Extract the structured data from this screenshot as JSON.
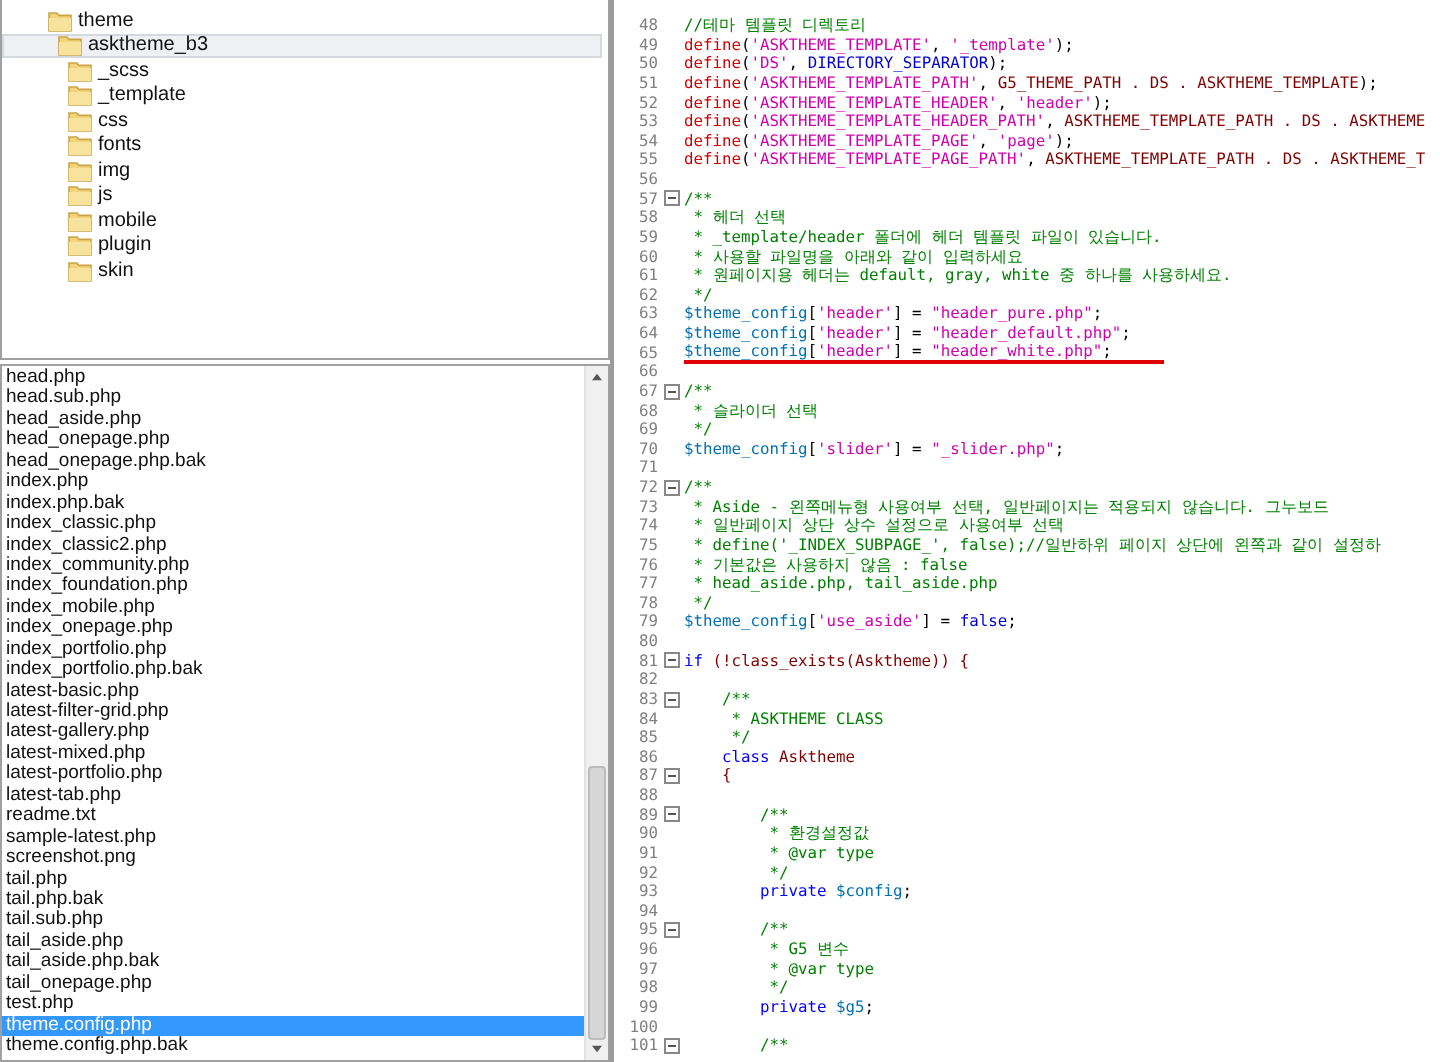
{
  "folder_tree": [
    {
      "label": "theme",
      "selected": false,
      "children": [
        {
          "label": "asktheme_b3",
          "selected": true,
          "children": [
            {
              "label": "_scss",
              "selected": false
            },
            {
              "label": "_template",
              "selected": false
            },
            {
              "label": "css",
              "selected": false
            },
            {
              "label": "fonts",
              "selected": false
            },
            {
              "label": "img",
              "selected": false
            },
            {
              "label": "js",
              "selected": false
            },
            {
              "label": "mobile",
              "selected": false
            },
            {
              "label": "plugin",
              "selected": false
            },
            {
              "label": "skin",
              "selected": false
            }
          ]
        }
      ]
    }
  ],
  "file_list": [
    {
      "name": "head.php",
      "selected": false
    },
    {
      "name": "head.sub.php",
      "selected": false
    },
    {
      "name": "head_aside.php",
      "selected": false
    },
    {
      "name": "head_onepage.php",
      "selected": false
    },
    {
      "name": "head_onepage.php.bak",
      "selected": false
    },
    {
      "name": "index.php",
      "selected": false
    },
    {
      "name": "index.php.bak",
      "selected": false
    },
    {
      "name": "index_classic.php",
      "selected": false
    },
    {
      "name": "index_classic2.php",
      "selected": false
    },
    {
      "name": "index_community.php",
      "selected": false
    },
    {
      "name": "index_foundation.php",
      "selected": false
    },
    {
      "name": "index_mobile.php",
      "selected": false
    },
    {
      "name": "index_onepage.php",
      "selected": false
    },
    {
      "name": "index_portfolio.php",
      "selected": false
    },
    {
      "name": "index_portfolio.php.bak",
      "selected": false
    },
    {
      "name": "latest-basic.php",
      "selected": false
    },
    {
      "name": "latest-filter-grid.php",
      "selected": false
    },
    {
      "name": "latest-gallery.php",
      "selected": false
    },
    {
      "name": "latest-mixed.php",
      "selected": false
    },
    {
      "name": "latest-portfolio.php",
      "selected": false
    },
    {
      "name": "latest-tab.php",
      "selected": false
    },
    {
      "name": "readme.txt",
      "selected": false
    },
    {
      "name": "sample-latest.php",
      "selected": false
    },
    {
      "name": "screenshot.png",
      "selected": false
    },
    {
      "name": "tail.php",
      "selected": false
    },
    {
      "name": "tail.php.bak",
      "selected": false
    },
    {
      "name": "tail.sub.php",
      "selected": false
    },
    {
      "name": "tail_aside.php",
      "selected": false
    },
    {
      "name": "tail_aside.php.bak",
      "selected": false
    },
    {
      "name": "tail_onepage.php",
      "selected": false
    },
    {
      "name": "test.php",
      "selected": false
    },
    {
      "name": "theme.config.php",
      "selected": true
    },
    {
      "name": "theme.config.php.bak",
      "selected": false
    }
  ],
  "code_lines": [
    {
      "number": "48",
      "fold": false,
      "underlined": false,
      "tokens": [
        {
          "kind": "comment",
          "text": "//테마 템플릿 디렉토리"
        }
      ]
    },
    {
      "number": "49",
      "fold": false,
      "underlined": false,
      "tokens": [
        {
          "kind": "function",
          "text": "define"
        },
        {
          "kind": "plain",
          "text": "("
        },
        {
          "kind": "string",
          "text": "'ASKTHEME_TEMPLATE'"
        },
        {
          "kind": "plain",
          "text": ", "
        },
        {
          "kind": "string",
          "text": "'_template'"
        },
        {
          "kind": "plain",
          "text": ");"
        }
      ]
    },
    {
      "number": "50",
      "fold": false,
      "underlined": false,
      "tokens": [
        {
          "kind": "function",
          "text": "define"
        },
        {
          "kind": "plain",
          "text": "("
        },
        {
          "kind": "string",
          "text": "'DS'"
        },
        {
          "kind": "plain",
          "text": ", "
        },
        {
          "kind": "constant",
          "text": "DIRECTORY_SEPARATOR"
        },
        {
          "kind": "plain",
          "text": ");"
        }
      ]
    },
    {
      "number": "51",
      "fold": false,
      "underlined": false,
      "tokens": [
        {
          "kind": "function",
          "text": "define"
        },
        {
          "kind": "plain",
          "text": "("
        },
        {
          "kind": "string",
          "text": "'ASKTHEME_TEMPLATE_PATH'"
        },
        {
          "kind": "plain",
          "text": ", "
        },
        {
          "kind": "identifier",
          "text": "G5_THEME_PATH . DS . ASKTHEME_TEMPLATE"
        },
        {
          "kind": "plain",
          "text": ");"
        }
      ]
    },
    {
      "number": "52",
      "fold": false,
      "underlined": false,
      "tokens": [
        {
          "kind": "function",
          "text": "define"
        },
        {
          "kind": "plain",
          "text": "("
        },
        {
          "kind": "string",
          "text": "'ASKTHEME_TEMPLATE_HEADER'"
        },
        {
          "kind": "plain",
          "text": ", "
        },
        {
          "kind": "string",
          "text": "'header'"
        },
        {
          "kind": "plain",
          "text": ");"
        }
      ]
    },
    {
      "number": "53",
      "fold": false,
      "underlined": false,
      "tokens": [
        {
          "kind": "function",
          "text": "define"
        },
        {
          "kind": "plain",
          "text": "("
        },
        {
          "kind": "string",
          "text": "'ASKTHEME_TEMPLATE_HEADER_PATH'"
        },
        {
          "kind": "plain",
          "text": ", "
        },
        {
          "kind": "identifier",
          "text": "ASKTHEME_TEMPLATE_PATH . DS . ASKTHEME"
        }
      ]
    },
    {
      "number": "54",
      "fold": false,
      "underlined": false,
      "tokens": [
        {
          "kind": "function",
          "text": "define"
        },
        {
          "kind": "plain",
          "text": "("
        },
        {
          "kind": "string",
          "text": "'ASKTHEME_TEMPLATE_PAGE'"
        },
        {
          "kind": "plain",
          "text": ", "
        },
        {
          "kind": "string",
          "text": "'page'"
        },
        {
          "kind": "plain",
          "text": ");"
        }
      ]
    },
    {
      "number": "55",
      "fold": false,
      "underlined": false,
      "tokens": [
        {
          "kind": "function",
          "text": "define"
        },
        {
          "kind": "plain",
          "text": "("
        },
        {
          "kind": "string",
          "text": "'ASKTHEME_TEMPLATE_PAGE_PATH'"
        },
        {
          "kind": "plain",
          "text": ", "
        },
        {
          "kind": "identifier",
          "text": "ASKTHEME_TEMPLATE_PATH . DS . ASKTHEME_T"
        }
      ]
    },
    {
      "number": "56",
      "fold": false,
      "underlined": false
    },
    {
      "number": "57",
      "fold": true,
      "underlined": false,
      "tokens": [
        {
          "kind": "comment",
          "text": "/**"
        }
      ]
    },
    {
      "number": "58",
      "fold": false,
      "underlined": false,
      "tokens": [
        {
          "kind": "comment",
          "text": " * 헤더 선택"
        }
      ]
    },
    {
      "number": "59",
      "fold": false,
      "underlined": false,
      "tokens": [
        {
          "kind": "comment",
          "text": " * _template/header 폴더에 헤더 템플릿 파일이 있습니다."
        }
      ]
    },
    {
      "number": "60",
      "fold": false,
      "underlined": false,
      "tokens": [
        {
          "kind": "comment",
          "text": " * 사용할 파일명을 아래와 같이 입력하세요"
        }
      ]
    },
    {
      "number": "61",
      "fold": false,
      "underlined": false,
      "tokens": [
        {
          "kind": "comment",
          "text": " * 원페이지용 헤더는 default, gray, white 중 하나를 사용하세요."
        }
      ]
    },
    {
      "number": "62",
      "fold": false,
      "underlined": false,
      "tokens": [
        {
          "kind": "comment",
          "text": " */"
        }
      ]
    },
    {
      "number": "63",
      "fold": false,
      "underlined": false,
      "tokens": [
        {
          "kind": "variable",
          "text": "$theme_config"
        },
        {
          "kind": "plain",
          "text": "["
        },
        {
          "kind": "string",
          "text": "'header'"
        },
        {
          "kind": "plain",
          "text": "] = "
        },
        {
          "kind": "string",
          "text": "\"header_pure.php\""
        },
        {
          "kind": "plain",
          "text": ";"
        }
      ]
    },
    {
      "number": "64",
      "fold": false,
      "underlined": false,
      "tokens": [
        {
          "kind": "variable",
          "text": "$theme_config"
        },
        {
          "kind": "plain",
          "text": "["
        },
        {
          "kind": "string",
          "text": "'header'"
        },
        {
          "kind": "plain",
          "text": "] = "
        },
        {
          "kind": "string",
          "text": "\"header_default.php\""
        },
        {
          "kind": "plain",
          "text": ";"
        }
      ]
    },
    {
      "number": "65",
      "fold": false,
      "underlined": true,
      "tokens": [
        {
          "kind": "variable",
          "text": "$theme_config"
        },
        {
          "kind": "plain",
          "text": "["
        },
        {
          "kind": "string",
          "text": "'header'"
        },
        {
          "kind": "plain",
          "text": "] = "
        },
        {
          "kind": "string",
          "text": "\"header_white.php\""
        },
        {
          "kind": "plain",
          "text": ";"
        }
      ]
    },
    {
      "number": "66",
      "fold": false,
      "underlined": false
    },
    {
      "number": "67",
      "fold": true,
      "underlined": false,
      "tokens": [
        {
          "kind": "comment",
          "text": "/**"
        }
      ]
    },
    {
      "number": "68",
      "fold": false,
      "underlined": false,
      "tokens": [
        {
          "kind": "comment",
          "text": " * 슬라이더 선택"
        }
      ]
    },
    {
      "number": "69",
      "fold": false,
      "underlined": false,
      "tokens": [
        {
          "kind": "comment",
          "text": " */"
        }
      ]
    },
    {
      "number": "70",
      "fold": false,
      "underlined": false,
      "tokens": [
        {
          "kind": "variable",
          "text": "$theme_config"
        },
        {
          "kind": "plain",
          "text": "["
        },
        {
          "kind": "string",
          "text": "'slider'"
        },
        {
          "kind": "plain",
          "text": "] = "
        },
        {
          "kind": "string",
          "text": "\"_slider.php\""
        },
        {
          "kind": "plain",
          "text": ";"
        }
      ]
    },
    {
      "number": "71",
      "fold": false,
      "underlined": false
    },
    {
      "number": "72",
      "fold": true,
      "underlined": false,
      "tokens": [
        {
          "kind": "comment",
          "text": "/**"
        }
      ]
    },
    {
      "number": "73",
      "fold": false,
      "underlined": false,
      "tokens": [
        {
          "kind": "comment",
          "text": " * Aside - 왼쪽메뉴형 사용여부 선택, 일반페이지는 적용되지 않습니다. 그누보드"
        }
      ]
    },
    {
      "number": "74",
      "fold": false,
      "underlined": false,
      "tokens": [
        {
          "kind": "comment",
          "text": " * 일반페이지 상단 상수 설정으로 사용여부 선택"
        }
      ]
    },
    {
      "number": "75",
      "fold": false,
      "underlined": false,
      "tokens": [
        {
          "kind": "comment",
          "text": " * define('_INDEX_SUBPAGE_', false);//일반하위 페이지 상단에 왼쪽과 같이 설정하"
        }
      ]
    },
    {
      "number": "76",
      "fold": false,
      "underlined": false,
      "tokens": [
        {
          "kind": "comment",
          "text": " * 기본값은 사용하지 않음 : false"
        }
      ]
    },
    {
      "number": "77",
      "fold": false,
      "underlined": false,
      "tokens": [
        {
          "kind": "comment",
          "text": " * head_aside.php, tail_aside.php"
        }
      ]
    },
    {
      "number": "78",
      "fold": false,
      "underlined": false,
      "tokens": [
        {
          "kind": "comment",
          "text": " */"
        }
      ]
    },
    {
      "number": "79",
      "fold": false,
      "underlined": false,
      "tokens": [
        {
          "kind": "variable",
          "text": "$theme_config"
        },
        {
          "kind": "plain",
          "text": "["
        },
        {
          "kind": "string",
          "text": "'use_aside'"
        },
        {
          "kind": "plain",
          "text": "] = "
        },
        {
          "kind": "constant",
          "text": "false"
        },
        {
          "kind": "plain",
          "text": ";"
        }
      ]
    },
    {
      "number": "80",
      "fold": false,
      "underlined": false
    },
    {
      "number": "81",
      "fold": true,
      "underlined": false,
      "tokens": [
        {
          "kind": "keyword",
          "text": "if "
        },
        {
          "kind": "identifier",
          "text": "(!class_exists(Asktheme)) {"
        }
      ]
    },
    {
      "number": "82",
      "fold": false,
      "underlined": false
    },
    {
      "number": "83",
      "fold": true,
      "underlined": false,
      "tokens": [
        {
          "kind": "comment",
          "text": "    /**"
        }
      ]
    },
    {
      "number": "84",
      "fold": false,
      "underlined": false,
      "tokens": [
        {
          "kind": "comment",
          "text": "     * ASKTHEME CLASS"
        }
      ]
    },
    {
      "number": "85",
      "fold": false,
      "underlined": false,
      "tokens": [
        {
          "kind": "comment",
          "text": "     */"
        }
      ]
    },
    {
      "number": "86",
      "fold": false,
      "underlined": false,
      "tokens": [
        {
          "kind": "keyword",
          "text": "    class "
        },
        {
          "kind": "identifier",
          "text": "Asktheme"
        }
      ]
    },
    {
      "number": "87",
      "fold": true,
      "underlined": false,
      "tokens": [
        {
          "kind": "identifier",
          "text": "    {"
        }
      ]
    },
    {
      "number": "88",
      "fold": false,
      "underlined": false
    },
    {
      "number": "89",
      "fold": true,
      "underlined": false,
      "tokens": [
        {
          "kind": "comment",
          "text": "        /**"
        }
      ]
    },
    {
      "number": "90",
      "fold": false,
      "underlined": false,
      "tokens": [
        {
          "kind": "comment",
          "text": "         * 환경설정값"
        }
      ]
    },
    {
      "number": "91",
      "fold": false,
      "underlined": false,
      "tokens": [
        {
          "kind": "comment",
          "text": "         * @var type"
        }
      ]
    },
    {
      "number": "92",
      "fold": false,
      "underlined": false,
      "tokens": [
        {
          "kind": "comment",
          "text": "         */"
        }
      ]
    },
    {
      "number": "93",
      "fold": false,
      "underlined": false,
      "tokens": [
        {
          "kind": "keyword",
          "text": "        private "
        },
        {
          "kind": "variable",
          "text": "$config"
        },
        {
          "kind": "plain",
          "text": ";"
        }
      ]
    },
    {
      "number": "94",
      "fold": false,
      "underlined": false
    },
    {
      "number": "95",
      "fold": true,
      "underlined": false,
      "tokens": [
        {
          "kind": "comment",
          "text": "        /**"
        }
      ]
    },
    {
      "number": "96",
      "fold": false,
      "underlined": false,
      "tokens": [
        {
          "kind": "comment",
          "text": "         * G5 변수"
        }
      ]
    },
    {
      "number": "97",
      "fold": false,
      "underlined": false,
      "tokens": [
        {
          "kind": "comment",
          "text": "         * @var type"
        }
      ]
    },
    {
      "number": "98",
      "fold": false,
      "underlined": false,
      "tokens": [
        {
          "kind": "comment",
          "text": "         */"
        }
      ]
    },
    {
      "number": "99",
      "fold": false,
      "underlined": false,
      "tokens": [
        {
          "kind": "keyword",
          "text": "        private "
        },
        {
          "kind": "variable",
          "text": "$g5"
        },
        {
          "kind": "plain",
          "text": ";"
        }
      ]
    },
    {
      "number": "100",
      "fold": false,
      "underlined": false
    },
    {
      "number": "101",
      "fold": true,
      "underlined": false,
      "tokens": [
        {
          "kind": "comment",
          "text": "        /**"
        }
      ]
    }
  ]
}
